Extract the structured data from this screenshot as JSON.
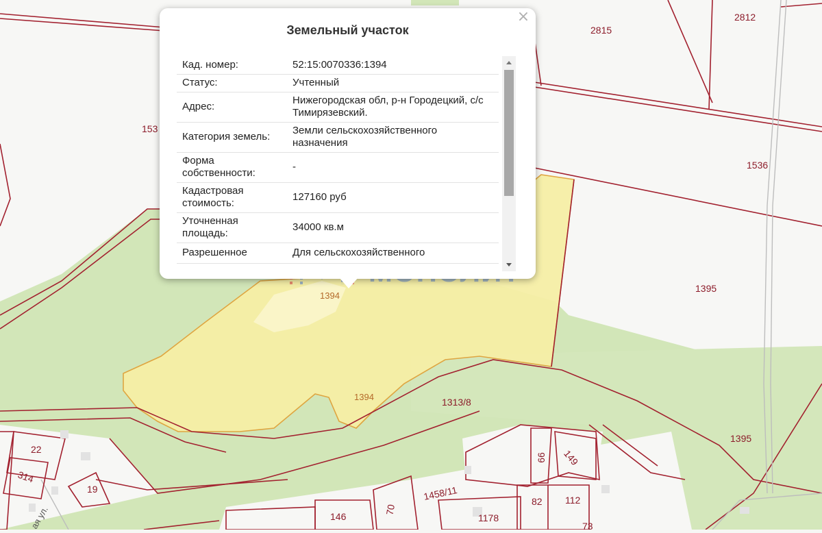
{
  "popup": {
    "title": "Земельный участок",
    "close": "×",
    "rows": [
      {
        "key": "Кад. номер:",
        "value": "52:15:0070336:1394"
      },
      {
        "key": "Статус:",
        "value": "Учтенный"
      },
      {
        "key": "Адрес:",
        "value": "Нижегородская обл, р-н Городецкий, с/с Тимирязевский."
      },
      {
        "key": "Категория земель:",
        "value": "Земли сельскохозяйственного назначения"
      },
      {
        "key": "Форма собственности:",
        "value": "-"
      },
      {
        "key": "Кадастровая стоимость:",
        "value": "127160 руб"
      },
      {
        "key": "Уточненная площадь:",
        "value": "34000 кв.м"
      },
      {
        "key": "Разрешенное",
        "value": "Для сельскохозяйственного"
      }
    ]
  },
  "watermark": {
    "text": "МОНОЛИТ"
  },
  "parcel_labels": {
    "p2815": "2815",
    "p2812": "2812",
    "p153": "153",
    "p1536": "1536",
    "p1395a": "1395",
    "p1395b": "1395",
    "p1394a": "1394",
    "p1394b": "1394",
    "p1313": "1313/8",
    "p22": "22",
    "p314": "314",
    "p19": "19",
    "p66": "66",
    "p149": "149",
    "p1458": "1458/11",
    "p146": "146",
    "p70": "70",
    "p1178": "1178",
    "p82": "82",
    "p112": "112",
    "p73": "73",
    "p_street": "ая ул."
  },
  "colors": {
    "boundary": "#a2212f",
    "green": "#d2e6b8",
    "selected_fill": "#f6efa6",
    "selected_border": "#e0a23a",
    "watermark": "#7e9cc8"
  }
}
